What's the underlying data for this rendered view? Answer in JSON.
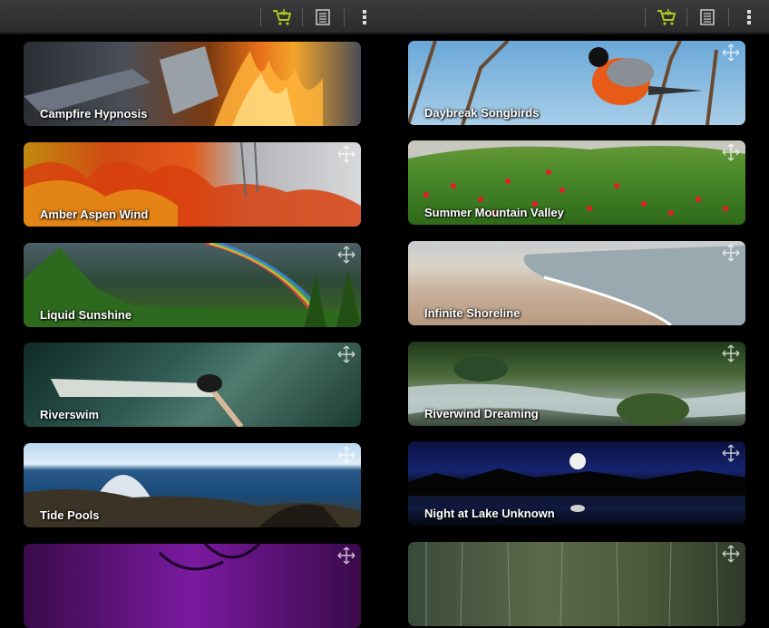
{
  "toolbar": {
    "left_icons": [
      "cart-icon",
      "list-icon",
      "overflow-menu-icon"
    ],
    "right_icons": [
      "cart-icon",
      "list-icon",
      "overflow-menu-icon"
    ],
    "accent": "#a9c920"
  },
  "tiles": {
    "left": [
      {
        "label": "Campfire Hypnosis"
      },
      {
        "label": "Amber Aspen Wind"
      },
      {
        "label": "Liquid Sunshine"
      },
      {
        "label": "Riverswim"
      },
      {
        "label": "Tide Pools"
      },
      {
        "label": ""
      }
    ],
    "right": [
      {
        "label": "Daybreak Songbirds"
      },
      {
        "label": "Summer Mountain Valley"
      },
      {
        "label": "Infinite Shoreline"
      },
      {
        "label": "Riverwind Dreaming"
      },
      {
        "label": "Night at Lake Unknown"
      },
      {
        "label": ""
      }
    ]
  }
}
